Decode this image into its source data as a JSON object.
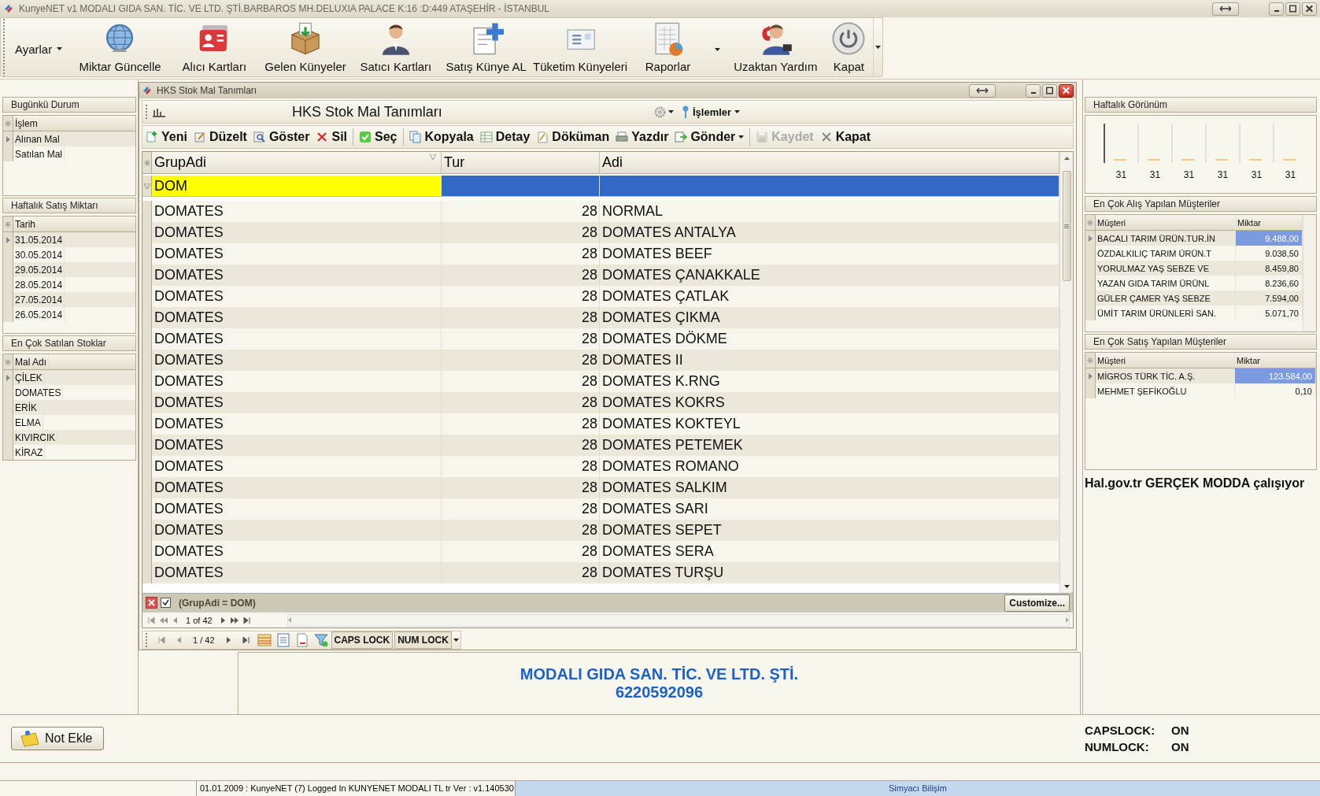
{
  "window": {
    "title": "KunyeNET v1 MODALI GIDA SAN. TİC. VE  LTD. ŞTİ.BARBAROS MH.DELUXIA PALACE K:16 :D:449 ATAŞEHİR - İSTANBUL"
  },
  "toolbar": {
    "menu": "Ayarlar",
    "buttons": [
      "Miktar Güncelle",
      "Alıcı Kartları",
      "Gelen Künyeler",
      "Satıcı Kartları",
      "Satış Künye AL",
      "Tüketim Künyeleri",
      "Raporlar",
      "Uzaktan Yardım",
      "Kapat"
    ]
  },
  "left_panels": [
    {
      "title": "Bugünkü Durum",
      "column": "İşlem",
      "rows": [
        {
          "text": "Alınan Mal",
          "selected": true
        },
        {
          "text": "Satılan Mal",
          "selected": false
        }
      ]
    },
    {
      "title": "Haftalık Satış Miktarı",
      "column": "Tarih",
      "rows": [
        {
          "text": "31.05.2014",
          "selected": true
        },
        {
          "text": "30.05.2014",
          "selected": false
        },
        {
          "text": "29.05.2014",
          "selected": false
        },
        {
          "text": "28.05.2014",
          "selected": false
        },
        {
          "text": "27.05.2014",
          "selected": false
        },
        {
          "text": "26.05.2014",
          "selected": false
        }
      ]
    },
    {
      "title": "En Çok Satılan Stoklar",
      "column": "Mal Adı",
      "rows": [
        {
          "text": "ÇİLEK",
          "selected": true
        },
        {
          "text": "DOMATES",
          "selected": false
        },
        {
          "text": "ERİK",
          "selected": false
        },
        {
          "text": "ELMA",
          "selected": false
        },
        {
          "text": "KIVIRCIK",
          "selected": false
        },
        {
          "text": "KİRAZ",
          "selected": false
        }
      ]
    }
  ],
  "child_window": {
    "title": "HKS Stok Mal Tanımları",
    "caption": "HKS Stok Mal Tanımları",
    "menu": "İşlemler",
    "actions": [
      {
        "label": "Yeni",
        "disabled": false
      },
      {
        "label": "Düzelt",
        "disabled": false
      },
      {
        "label": "Göster",
        "disabled": false
      },
      {
        "label": "Sil",
        "disabled": false
      },
      {
        "label": "Seç",
        "disabled": false
      },
      {
        "label": "Kopyala",
        "disabled": false
      },
      {
        "label": "Detay",
        "disabled": false
      },
      {
        "label": "Döküman",
        "disabled": false
      },
      {
        "label": "Yazdır",
        "disabled": false
      },
      {
        "label": "Gönder",
        "disabled": false
      },
      {
        "label": "Kaydet",
        "disabled": true
      },
      {
        "label": "Kapat",
        "disabled": false
      }
    ],
    "grid": {
      "columns": [
        "GrupAdi",
        "Tur",
        "Adi"
      ],
      "filter_value": "DOM",
      "rows": [
        {
          "grup": "DOMATES",
          "tur": "28",
          "adi": "NORMAL"
        },
        {
          "grup": "DOMATES",
          "tur": "28",
          "adi": "DOMATES ANTALYA"
        },
        {
          "grup": "DOMATES",
          "tur": "28",
          "adi": "DOMATES BEEF"
        },
        {
          "grup": "DOMATES",
          "tur": "28",
          "adi": "DOMATES ÇANAKKALE"
        },
        {
          "grup": "DOMATES",
          "tur": "28",
          "adi": "DOMATES ÇATLAK"
        },
        {
          "grup": "DOMATES",
          "tur": "28",
          "adi": "DOMATES ÇIKMA"
        },
        {
          "grup": "DOMATES",
          "tur": "28",
          "adi": "DOMATES DÖKME"
        },
        {
          "grup": "DOMATES",
          "tur": "28",
          "adi": "DOMATES II"
        },
        {
          "grup": "DOMATES",
          "tur": "28",
          "adi": "DOMATES K.RNG"
        },
        {
          "grup": "DOMATES",
          "tur": "28",
          "adi": "DOMATES KOKRS"
        },
        {
          "grup": "DOMATES",
          "tur": "28",
          "adi": "DOMATES KOKTEYL"
        },
        {
          "grup": "DOMATES",
          "tur": "28",
          "adi": "DOMATES PETEMEK"
        },
        {
          "grup": "DOMATES",
          "tur": "28",
          "adi": "DOMATES ROMANO"
        },
        {
          "grup": "DOMATES",
          "tur": "28",
          "adi": "DOMATES SALKIM"
        },
        {
          "grup": "DOMATES",
          "tur": "28",
          "adi": "DOMATES SARI"
        },
        {
          "grup": "DOMATES",
          "tur": "28",
          "adi": "DOMATES SEPET"
        },
        {
          "grup": "DOMATES",
          "tur": "28",
          "adi": "DOMATES SERA"
        },
        {
          "grup": "DOMATES",
          "tur": "28",
          "adi": "DOMATES TURŞU"
        }
      ],
      "filter_enabled": true,
      "filter_text": "(GrupAdi = DOM)",
      "customize": "Customize...",
      "pager": "1 of 42"
    },
    "navigator": {
      "position": "1 / 42",
      "keys": [
        "CAPS LOCK",
        "NUM LOCK"
      ]
    }
  },
  "right_panels": {
    "chart_title": "Haftalık Görünüm",
    "chart_labels": [
      "31",
      "31",
      "31",
      "31",
      "31",
      "31"
    ],
    "tables": [
      {
        "title": "En Çok Alış Yapılan Müşteriler",
        "columns": [
          "Müşteri",
          "Miktar"
        ],
        "rows": [
          {
            "name": "BACALI TARIM ÜRÜN.TUR.İN",
            "amount": "9.488,00",
            "selected": true
          },
          {
            "name": "ÖZDALKILIÇ TARIM ÜRÜN.T",
            "amount": "9.038,50",
            "selected": false
          },
          {
            "name": "YORULMAZ YAŞ SEBZE VE",
            "amount": "8.459,80",
            "selected": false
          },
          {
            "name": "YAZAN GIDA TARIM ÜRÜNL",
            "amount": "8.236,60",
            "selected": false
          },
          {
            "name": "GÜLER ÇAMER YAŞ SEBZE",
            "amount": "7.594,00",
            "selected": false
          },
          {
            "name": "ÜMİT TARIM ÜRÜNLERİ SAN.",
            "amount": "5.071,70",
            "selected": false
          }
        ]
      },
      {
        "title": "En Çok Satış Yapılan Müşteriler",
        "columns": [
          "Müşteri",
          "Miktar"
        ],
        "rows": [
          {
            "name": "MİGROS TÜRK TİC. A.Ş.",
            "amount": "123.584,00",
            "selected": true
          },
          {
            "name": "MEHMET ŞEFİKOĞLU",
            "amount": "0,10",
            "selected": false
          }
        ]
      }
    ],
    "notice": "Hal.gov.tr GERÇEK MODDA çalışıyor"
  },
  "company": {
    "name": "MODALI GIDA SAN. TİC. VE  LTD. ŞTİ.",
    "phone": "6220592096"
  },
  "note_button": "Not Ekle",
  "lock_status": [
    {
      "label": "CAPSLOCK:",
      "value": "ON"
    },
    {
      "label": "NUMLOCK:",
      "value": "ON"
    }
  ],
  "status_bar": [
    "01.01.2009 : KunyeNET (7) Logged In KUNYENET MODALI TL tr Ver : v1.140530",
    "Simyacı Bilişim"
  ]
}
